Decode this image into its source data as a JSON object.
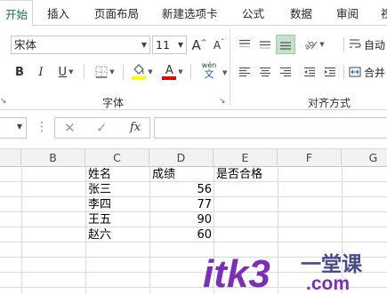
{
  "tabs": [
    {
      "label": "开始",
      "active": true
    },
    {
      "label": "插入"
    },
    {
      "label": "页面布局"
    },
    {
      "label": "新建选项卡"
    },
    {
      "label": "公式"
    },
    {
      "label": "数据"
    },
    {
      "label": "审阅"
    },
    {
      "label": "视"
    }
  ],
  "font_group": {
    "font_name": "宋体",
    "font_size": "11",
    "grow_label": "A",
    "shrink_label": "A",
    "bold_label": "B",
    "italic_label": "I",
    "underline_label": "U",
    "phonetic_top": "wén",
    "phonetic_bottom": "文",
    "font_color_label": "A",
    "group_label": "字体",
    "fill_color": "#ffff00",
    "font_color": "#e00000"
  },
  "align_group": {
    "group_label": "对齐方式",
    "wrap_label": "自动",
    "merge_label": "合并"
  },
  "formula_bar": {
    "cancel_symbol": "✕",
    "enter_symbol": "✓",
    "fx_label": "fx",
    "formula": ""
  },
  "columns": [
    "B",
    "C",
    "D",
    "E",
    "F",
    "G"
  ],
  "table": {
    "headers": [
      "姓名",
      "成绩",
      "是否合格"
    ],
    "rows": [
      {
        "name": "张三",
        "score": "56",
        "pass": ""
      },
      {
        "name": "李四",
        "score": "77",
        "pass": ""
      },
      {
        "name": "王五",
        "score": "90",
        "pass": ""
      },
      {
        "name": "赵六",
        "score": "60",
        "pass": ""
      }
    ]
  },
  "watermark": {
    "brand": "itk3",
    "tagline": "一堂课",
    "domain": ".com",
    "primary_color": "#7b2fb5",
    "accent_color": "#4a4a8a"
  },
  "colors": {
    "accent": "#1e7145",
    "highlight": "#c5e0cb"
  }
}
